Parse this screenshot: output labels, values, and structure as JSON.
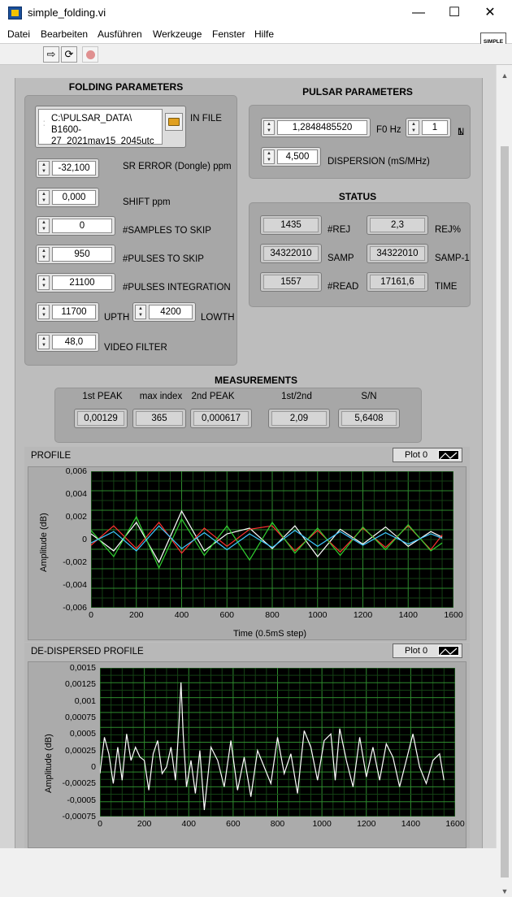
{
  "window": {
    "title": "simple_folding.vi",
    "minimize": "—",
    "maximize": "☐",
    "close": "✕"
  },
  "menu": [
    "Datei",
    "Bearbeiten",
    "Ausführen",
    "Werkzeuge",
    "Fenster",
    "Hilfe"
  ],
  "vi_logo": "SIMPLE FOLDING",
  "folding": {
    "title": "FOLDING PARAMETERS",
    "infile_path": "C:\\PULSAR_DATA\\ B1600- 27_2021may15_2045utc",
    "infile_label": "IN FILE",
    "controls": [
      {
        "label": "SR ERROR (Dongle) ppm",
        "value": "-32,100"
      },
      {
        "label": "SHIFT ppm",
        "value": "0,000"
      },
      {
        "label": "#SAMPLES TO SKIP",
        "value": "0"
      },
      {
        "label": "#PULSES TO SKIP",
        "value": "950"
      },
      {
        "label": "#PULSES INTEGRATION",
        "value": "21100"
      }
    ],
    "upth": {
      "label": "UPTH",
      "value": "11700"
    },
    "lowth": {
      "label": "LOWTH",
      "value": "4200"
    },
    "video": {
      "label": "VIDEO FILTER",
      "value": "48,0"
    }
  },
  "pulsar": {
    "title": "PULSAR PARAMETERS",
    "f0": {
      "label": "F0 Hz",
      "value": "1,2848485520"
    },
    "n": {
      "label": "N",
      "value": "1"
    },
    "dispersion": {
      "label": "DISPERSION (mS/MHz)",
      "value": "4,500"
    }
  },
  "status": {
    "title": "STATUS",
    "rej": {
      "label": "#REJ",
      "value": "1435"
    },
    "rejpct": {
      "label": "REJ%",
      "value": "2,3"
    },
    "samp": {
      "label": "SAMP",
      "value": "34322010"
    },
    "samp1": {
      "label": "SAMP-1",
      "value": "34322010"
    },
    "read": {
      "label": "#READ",
      "value": "1557"
    },
    "time": {
      "label": "TIME",
      "value": "17161,6"
    }
  },
  "measurements": {
    "title": "MEASUREMENTS",
    "items": [
      {
        "label": "1st PEAK",
        "value": "0,00129"
      },
      {
        "label": "max index",
        "value": "365"
      },
      {
        "label": "2nd PEAK",
        "value": "0,000617"
      },
      {
        "label": "1st/2nd",
        "value": "2,09"
      },
      {
        "label": "S/N",
        "value": "5,6408"
      }
    ]
  },
  "profile": {
    "title": "PROFILE",
    "legend": "Plot 0",
    "ylabel": "Amplitude (dB)",
    "xlabel": "Time (0.5mS step)",
    "yticks": [
      "0,006",
      "0,004",
      "0,002",
      "0",
      "-0,002",
      "-0,004",
      "-0,006"
    ],
    "xticks": [
      "0",
      "200",
      "400",
      "600",
      "800",
      "1000",
      "1200",
      "1400",
      "1600"
    ]
  },
  "dedispersed": {
    "title": "DE-DISPERSED PROFILE",
    "legend": "Plot 0",
    "ylabel": "Amplitude (dB)",
    "yticks": [
      "0,0015",
      "0,00125",
      "0,001",
      "0,00075",
      "0,0005",
      "0,00025",
      "0",
      "-0,00025",
      "-0,0005",
      "-0,00075"
    ],
    "xticks": [
      "0",
      "200",
      "400",
      "600",
      "800",
      "1000",
      "1200",
      "1400",
      "1600"
    ]
  },
  "chart_data": [
    {
      "type": "line",
      "title": "PROFILE",
      "xlabel": "Time (0.5mS step)",
      "ylabel": "Amplitude (dB)",
      "xlim": [
        0,
        1600
      ],
      "ylim": [
        -0.006,
        0.006
      ],
      "grid": true,
      "series": [
        {
          "color": "#ffffff",
          "x": [
            0,
            100,
            200,
            300,
            400,
            500,
            600,
            700,
            800,
            900,
            1000,
            1100,
            1200,
            1300,
            1400,
            1500,
            1550
          ],
          "y": [
            0.0005,
            -0.001,
            0.0015,
            -0.002,
            0.0025,
            -0.001,
            0.0005,
            0.001,
            -0.0008,
            0.0012,
            -0.0015,
            0.0009,
            -0.0004,
            0.0011,
            -0.0006,
            0.0007,
            0.0002
          ]
        },
        {
          "color": "#ff3030",
          "x": [
            0,
            100,
            200,
            300,
            400,
            500,
            600,
            700,
            800,
            900,
            1000,
            1100,
            1200,
            1300,
            1400,
            1500,
            1550
          ],
          "y": [
            -0.0005,
            0.0012,
            -0.0008,
            0.0015,
            -0.0012,
            0.001,
            -0.0006,
            0.0009,
            0.0012,
            -0.001,
            0.0008,
            -0.0011,
            0.001,
            -0.0007,
            0.0012,
            -0.0009,
            0.0004
          ]
        },
        {
          "color": "#30d030",
          "x": [
            0,
            100,
            200,
            300,
            400,
            500,
            600,
            700,
            800,
            900,
            1000,
            1100,
            1200,
            1300,
            1400,
            1500,
            1550
          ],
          "y": [
            0.0008,
            -0.0015,
            0.002,
            -0.0025,
            0.0018,
            -0.0014,
            0.0012,
            -0.0018,
            0.0015,
            -0.0012,
            0.001,
            -0.0014,
            0.0011,
            -0.0009,
            0.0013,
            -0.001,
            -0.0003
          ]
        },
        {
          "color": "#40c8ff",
          "x": [
            0,
            100,
            200,
            300,
            400,
            500,
            600,
            700,
            800,
            900,
            1000,
            1100,
            1200,
            1300,
            1400,
            1500,
            1550
          ],
          "y": [
            -0.0003,
            0.0007,
            -0.001,
            0.0012,
            -0.0008,
            0.0006,
            -0.0009,
            0.0005,
            -0.0007,
            0.0008,
            -0.0006,
            0.0007,
            -0.0005,
            0.0006,
            -0.0004,
            0.0005,
            0.0001
          ]
        }
      ]
    },
    {
      "type": "line",
      "title": "DE-DISPERSED PROFILE",
      "ylabel": "Amplitude (dB)",
      "xlim": [
        0,
        1600
      ],
      "ylim": [
        -0.00075,
        0.0015
      ],
      "grid": true,
      "series": [
        {
          "color": "#ffffff",
          "x": [
            0,
            20,
            40,
            60,
            80,
            100,
            120,
            140,
            160,
            180,
            200,
            220,
            240,
            260,
            280,
            300,
            320,
            340,
            355,
            365,
            375,
            390,
            410,
            430,
            450,
            470,
            500,
            530,
            560,
            590,
            620,
            650,
            680,
            710,
            740,
            770,
            800,
            830,
            860,
            890,
            920,
            950,
            980,
            1010,
            1040,
            1060,
            1080,
            1110,
            1140,
            1170,
            1200,
            1230,
            1260,
            1290,
            1320,
            1350,
            1380,
            1410,
            1440,
            1470,
            1500,
            1530,
            1550
          ],
          "y": [
            -0.0001,
            0.00045,
            0.0002,
            -0.00025,
            0.0003,
            -0.0002,
            0.0005,
            0.0001,
            0.0003,
            0.00015,
            0.0001,
            -0.00035,
            0.0002,
            0.0004,
            -0.0001,
            0.0,
            0.0003,
            -0.0002,
            0.0006,
            0.00128,
            0.0005,
            -0.0003,
            0.0001,
            -0.0004,
            0.00025,
            -0.00065,
            0.0003,
            0.0001,
            -0.0003,
            0.0004,
            -0.00035,
            0.00015,
            -0.00045,
            0.00025,
            0.0,
            -0.00025,
            0.00045,
            -0.0001,
            0.0002,
            -0.0004,
            0.00055,
            0.0003,
            -0.0002,
            0.0004,
            0.0005,
            -0.0002,
            0.00058,
            0.0001,
            -0.0003,
            0.00045,
            -0.00015,
            0.0003,
            -0.0002,
            0.00035,
            0.00015,
            -0.0003,
            0.0001,
            0.0005,
            0.0,
            -0.00025,
            0.0001,
            0.0002,
            -0.0002
          ]
        }
      ]
    }
  ]
}
